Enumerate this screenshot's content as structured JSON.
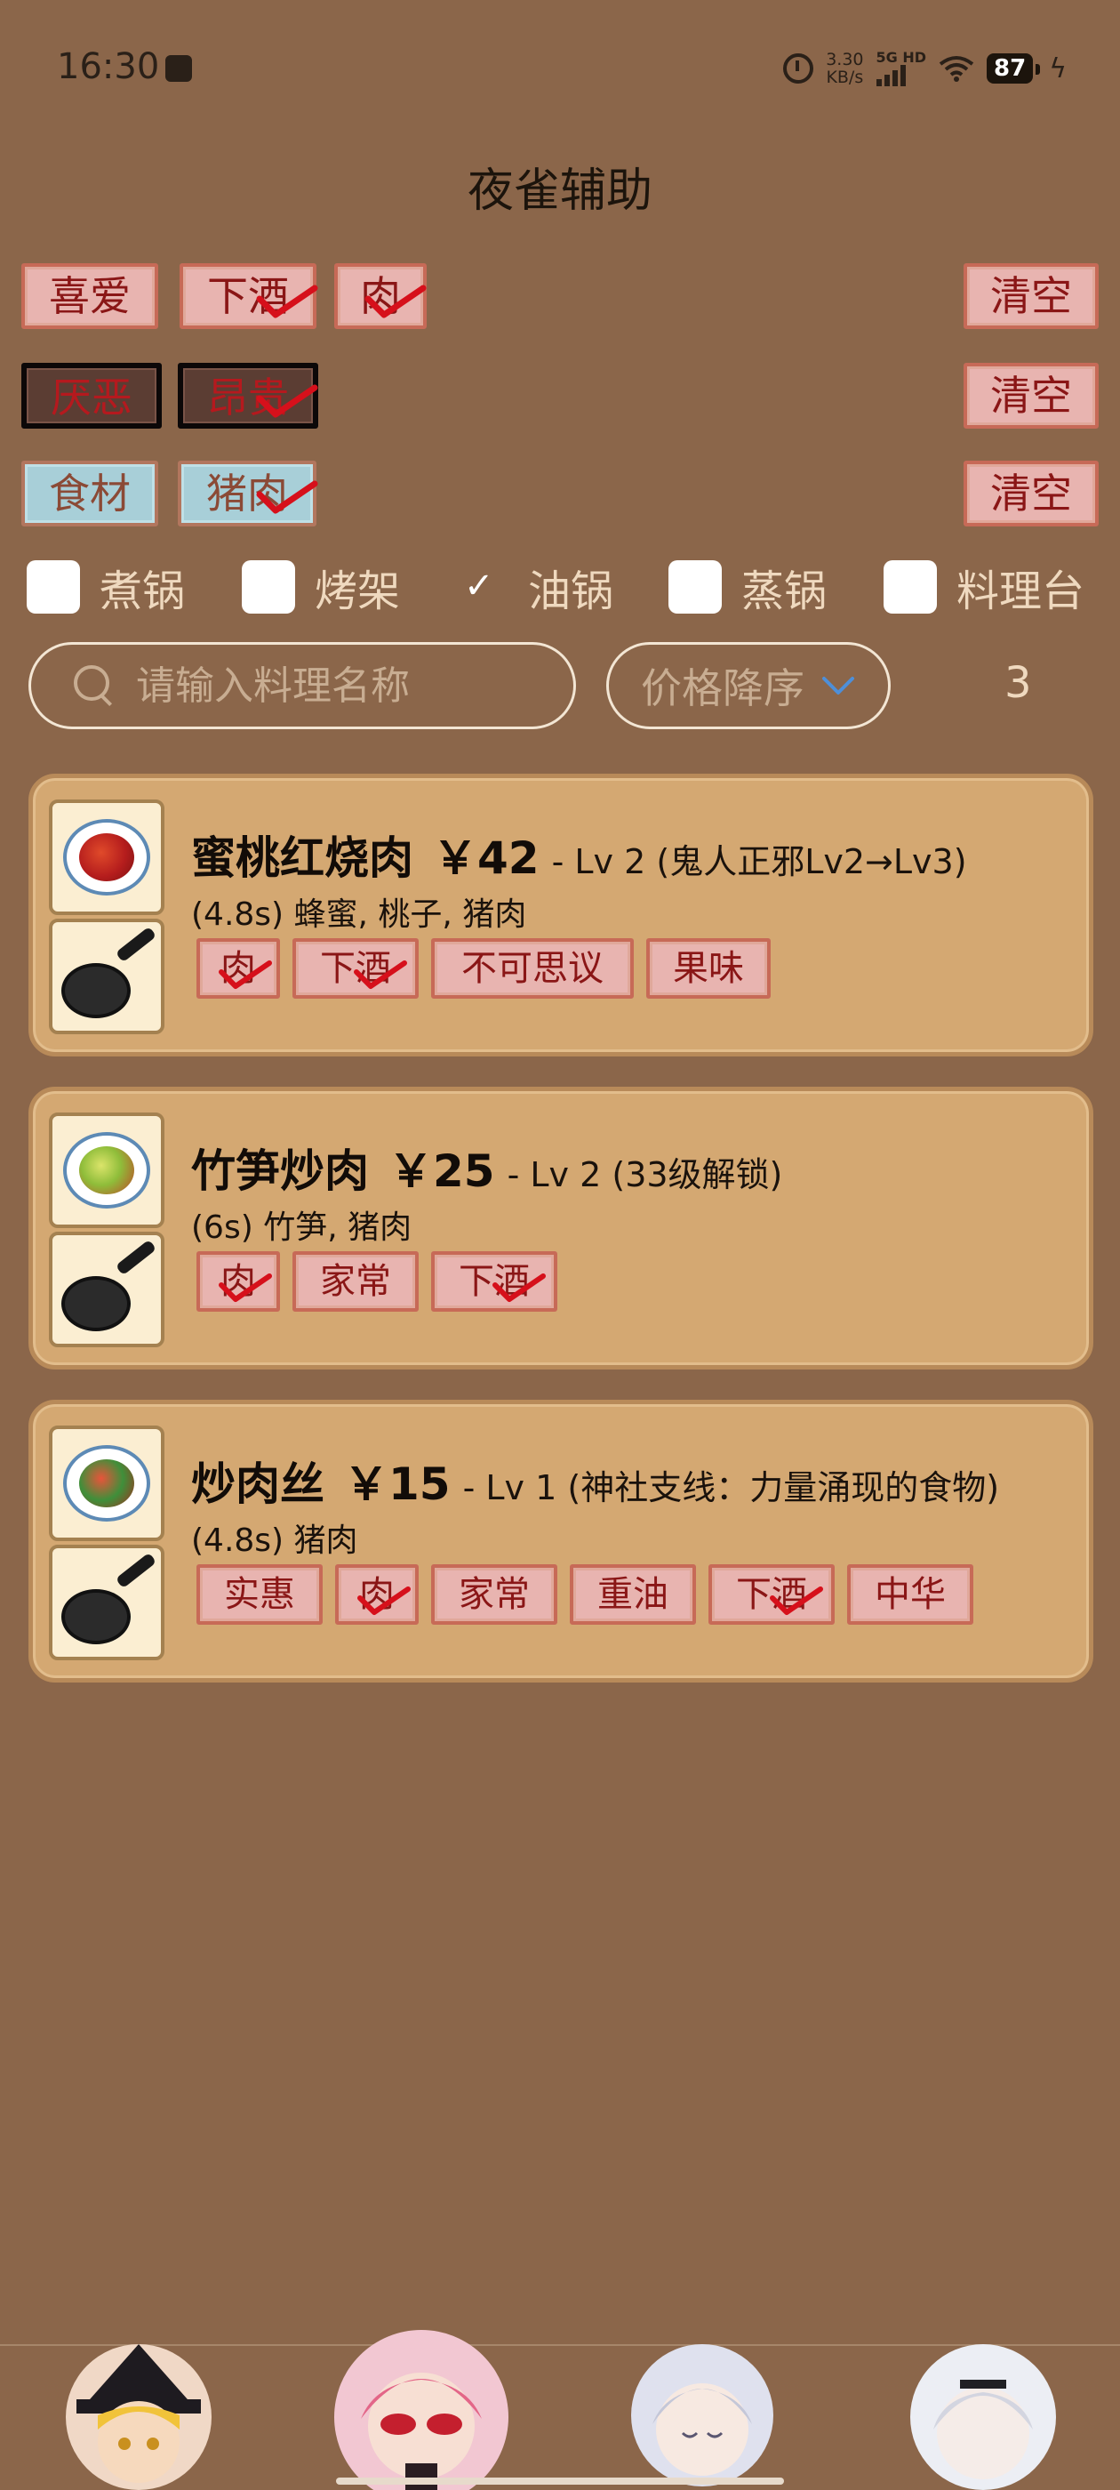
{
  "status_bar": {
    "time": "16:30",
    "net_speed_value": "3.30",
    "net_speed_unit": "KB/s",
    "signal_label": "5G HD",
    "battery": "87"
  },
  "app_title": "夜雀辅助",
  "tag_rows": {
    "likes": {
      "label": "喜爱",
      "tags": [
        "下酒",
        "肉"
      ],
      "clear_label": "清空"
    },
    "dislikes": {
      "label": "厌恶",
      "tags": [
        "昂贵"
      ],
      "clear_label": "清空"
    },
    "ingredients": {
      "label": "食材",
      "tags": [
        "猪肉"
      ],
      "clear_label": "清空"
    }
  },
  "cookers": [
    {
      "label": "煮锅",
      "checked": false
    },
    {
      "label": "烤架",
      "checked": false
    },
    {
      "label": "油锅",
      "checked": true
    },
    {
      "label": "蒸锅",
      "checked": false
    },
    {
      "label": "料理台",
      "checked": false
    }
  ],
  "search": {
    "placeholder": "请输入料理名称",
    "value": ""
  },
  "sort": {
    "selected": "价格降序"
  },
  "result_count": "3",
  "recipes": [
    {
      "name": "蜜桃红烧肉",
      "price": "￥42",
      "meta": "- Lv 2 (鬼人正邪Lv2→Lv3)",
      "ingredients": "(4.8s) 蜂蜜, 桃子, 猪肉",
      "tags": [
        {
          "label": "肉",
          "checked": true
        },
        {
          "label": "下酒",
          "checked": true
        },
        {
          "label": "不可思议",
          "checked": false
        },
        {
          "label": "果味",
          "checked": false
        }
      ]
    },
    {
      "name": "竹笋炒肉",
      "price": "￥25",
      "meta": "- Lv 2 (33级解锁)",
      "ingredients": "(6s) 竹笋, 猪肉",
      "tags": [
        {
          "label": "肉",
          "checked": true
        },
        {
          "label": "家常",
          "checked": false
        },
        {
          "label": "下酒",
          "checked": true
        }
      ]
    },
    {
      "name": "炒肉丝",
      "price": "￥15",
      "meta": "- Lv 1 (神社支线：力量涌现的食物)",
      "ingredients": "(4.8s) 猪肉",
      "tags": [
        {
          "label": "实惠",
          "checked": false
        },
        {
          "label": "肉",
          "checked": true
        },
        {
          "label": "家常",
          "checked": false
        },
        {
          "label": "重油",
          "checked": false
        },
        {
          "label": "下酒",
          "checked": true
        },
        {
          "label": "中华",
          "checked": false
        }
      ]
    }
  ],
  "icons": {
    "check": "check-icon",
    "search": "search-icon",
    "dropdown": "chevron-down-icon",
    "cooker": "frying-pan-icon"
  },
  "colors": {
    "background": "#8b664a",
    "card": "#d4a872",
    "tag_pink": "#e8b4b0",
    "tag_dark": "#5b3d33",
    "tag_blue": "#a8cfd8",
    "check_red": "#d6101b",
    "accent_blue": "#4e8fd8"
  }
}
